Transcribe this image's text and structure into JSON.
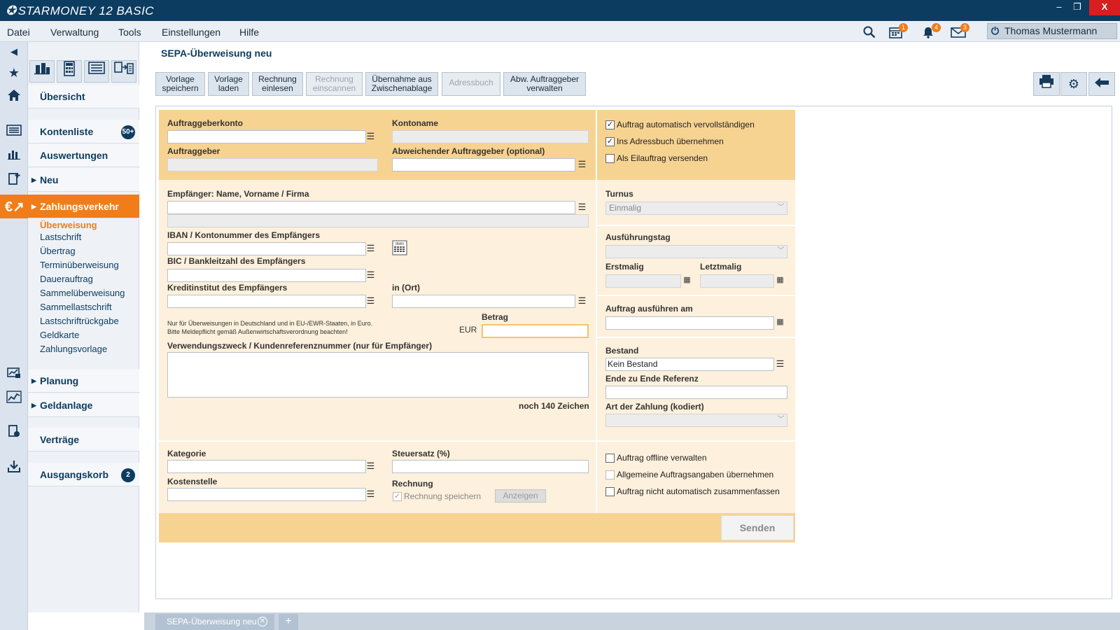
{
  "app": {
    "title": "STARMONEY 12 BASIC"
  },
  "window": {
    "minimize": "–",
    "maximize": "❐",
    "close": "X"
  },
  "menu": [
    "Datei",
    "Verwaltung",
    "Tools",
    "Einstellungen",
    "Hilfe"
  ],
  "header": {
    "calendar_badge": "1",
    "bell_badge": "4",
    "mail_badge": "3",
    "user_name": "Thomas Mustermann"
  },
  "sidebar": {
    "nav": {
      "uebersicht": "Übersicht",
      "kontenliste": "Kontenliste",
      "kontenliste_badge": "50+",
      "auswertungen": "Auswertungen",
      "neu": "Neu",
      "zahlungsverkehr": "Zahlungsverkehr",
      "planung": "Planung",
      "geldanlage": "Geldanlage",
      "vertraege": "Verträge",
      "ausgangskorb": "Ausgangskorb",
      "ausgangskorb_badge": "2"
    },
    "sub": [
      "Überweisung",
      "Lastschrift",
      "Übertrag",
      "Terminüberweisung",
      "Dauerauftrag",
      "Sammelüberweisung",
      "Sammellastschrift",
      "Lastschriftrückgabe",
      "Geldkarte",
      "Zahlungsvorlage"
    ]
  },
  "page": {
    "title": "SEPA-Überweisung neu"
  },
  "toolbar": [
    [
      "Vorlage",
      "speichern"
    ],
    [
      "Vorlage",
      "laden"
    ],
    [
      "Rechnung",
      "einlesen"
    ],
    [
      "Rechnung",
      "einscannen"
    ],
    [
      "Übernahme aus",
      "Zwischenablage"
    ],
    [
      "Adressbuch",
      ""
    ],
    [
      "Abw. Auftraggeber",
      "verwalten"
    ]
  ],
  "form": {
    "auftraggeberkonto": "Auftraggeberkonto",
    "kontoname": "Kontoname",
    "auftraggeber": "Auftraggeber",
    "abw_auftraggeber": "Abweichender Auftraggeber (optional)",
    "empfaenger": "Empfänger: Name, Vorname / Firma",
    "iban": "IBAN / Kontonummer des Empfängers",
    "iban_icon": "IBAN",
    "bic": "BIC / Bankleitzahl des Empfängers",
    "kreditinstitut": "Kreditinstitut des Empfängers",
    "ort": "in (Ort)",
    "note1": "Nur für Überweisungen in Deutschland und in EU-/EWR-Staaten, in Euro.",
    "note2": "Bitte Meldepflicht gemäß Außenwirtschaftsverordnung beachten!",
    "betrag": "Betrag",
    "currency": "EUR",
    "verwendungszweck": "Verwendungszweck / Kundenreferenznummer (nur für Empfänger)",
    "remaining": "noch 140 Zeichen",
    "kategorie": "Kategorie",
    "kostenstelle": "Kostenstelle",
    "steuersatz": "Steuersatz (%)",
    "rechnung": "Rechnung",
    "rechnung_speichern": "Rechnung speichern",
    "anzeigen": "Anzeigen",
    "opt_auto": "Auftrag automatisch vervollständigen",
    "opt_adress": "Ins Adressbuch übernehmen",
    "opt_eil": "Als Eilauftrag versenden",
    "turnus": "Turnus",
    "turnus_value": "Einmalig",
    "ausfuehrungstag": "Ausführungstag",
    "erstmalig": "Erstmalig",
    "letztmalig": "Letztmalig",
    "ausfuehren_am": "Auftrag ausführen am",
    "bestand": "Bestand",
    "bestand_value": "Kein Bestand",
    "e2e": "Ende zu Ende Referenz",
    "art_zahlung": "Art der Zahlung (kodiert)",
    "opt_offline": "Auftrag offline verwalten",
    "opt_allgemein": "Allgemeine Auftragsangaben übernehmen",
    "opt_zusammen": "Auftrag nicht automatisch zusammenfassen",
    "senden": "Senden"
  },
  "tabs": {
    "active": "SEPA-Überweisung neu",
    "add": "+"
  }
}
